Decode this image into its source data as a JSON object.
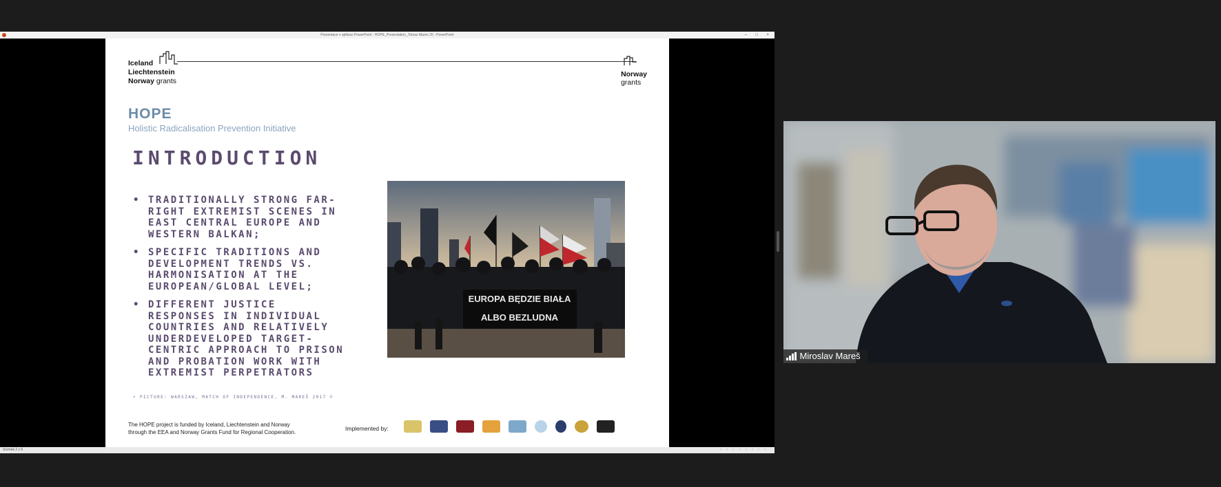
{
  "window": {
    "title": "Prezentace v aplikaci PowerPoint - HOPE_Presentation_Tomas Mares 20 - PowerPoint",
    "controls": [
      "–",
      "□",
      "×"
    ]
  },
  "statusbar": {
    "left": "Snímek 2 z 6"
  },
  "slide": {
    "logo_left": {
      "line1": "Iceland",
      "line2": "Liechtenstein",
      "line3_bold": "Norway",
      "line3_thin": "grants"
    },
    "logo_right": {
      "line1": "Norway",
      "line2": "grants"
    },
    "hope_logo": "HOPE",
    "hope_subtitle": "Holistic Radicalisation Prevention Initiative",
    "title": "INTRODUCTION",
    "bullets": [
      "TRADITIONALLY STRONG FAR-RIGHT EXTREMIST SCENES IN EAST CENTRAL EUROPE AND WESTERN BALKAN;",
      "SPECIFIC TRADITIONS AND DEVELOPMENT TRENDS VS. HARMONISATION AT THE EUROPEAN/GLOBAL LEVEL;",
      "DIFFERENT JUSTICE RESPONSES IN INDIVIDUAL COUNTRIES AND RELATIVELY UNDERDEVELOPED TARGET-CENTRIC APPROACH TO PRISON AND PROBATION WORK WITH EXTREMIST PERPETRATORS"
    ],
    "caption": "•   PICTURE: WARSZAW, MATCH OF INDEPENDENCE, M. MAREŠ 2017 ©",
    "photo_banner": {
      "line1": "EUROPA BĘDZIE BIAŁA",
      "line2": "ALBO BEZLUDNA"
    },
    "footer": {
      "line1": "The HOPE project is funded by Iceland, Liechtenstein and Norway",
      "line2": "through the EEA and Norway Grants Fund for Regional Cooperation.",
      "implemented_by": "Implemented by:"
    }
  },
  "participant": {
    "name": "Miroslav Mareš"
  },
  "colors": {
    "title_purple": "#5a4b6e",
    "hope_blue": "#6d8ca8",
    "background": "#1c1c1c"
  }
}
